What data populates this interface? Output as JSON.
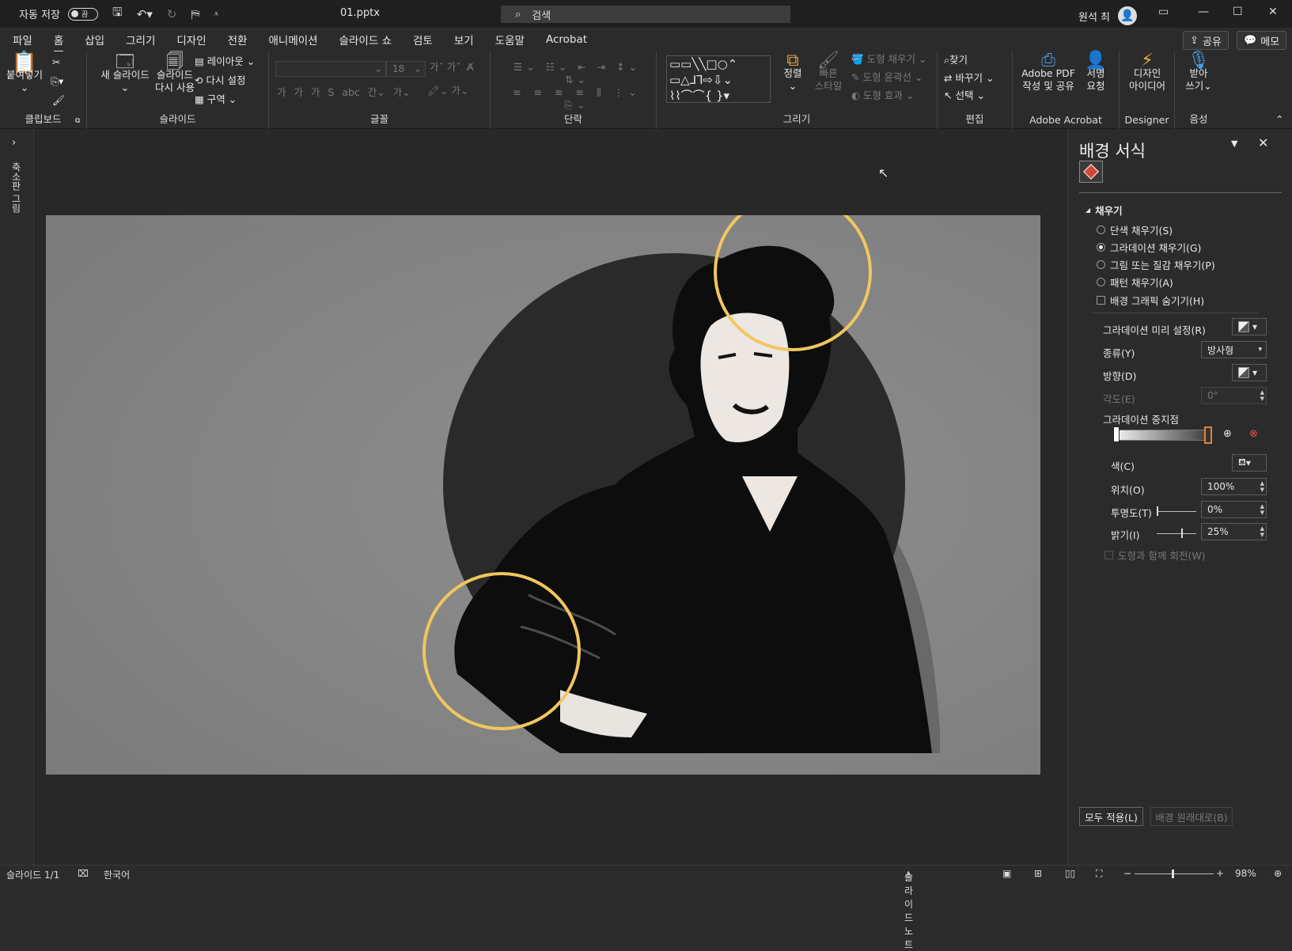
{
  "titlebar": {
    "autosave_label": "자동 저장",
    "autosave_state": "끔",
    "filename": "01.pptx",
    "search_placeholder": "검색",
    "username": "원석 최"
  },
  "menu": {
    "tabs": [
      "파일",
      "홈",
      "삽입",
      "그리기",
      "디자인",
      "전환",
      "애니메이션",
      "슬라이드 쇼",
      "검토",
      "보기",
      "도움말",
      "Acrobat"
    ],
    "active": "홈",
    "share_label": "공유",
    "comment_label": "메모"
  },
  "ribbon": {
    "clipboard": {
      "paste": "붙여넣기",
      "label": "클립보드"
    },
    "slides": {
      "new_slide": "새 슬라이드",
      "reuse_1": "슬라이드",
      "reuse_2": "다시 사용",
      "layout": "레이아웃",
      "reset": "다시 설정",
      "section": "구역",
      "label": "슬라이드"
    },
    "font": {
      "size": "18",
      "label": "글꼴"
    },
    "paragraph": {
      "label": "단락"
    },
    "drawing": {
      "arrange": "정렬",
      "quick_style_1": "빠른",
      "quick_style_2": "스타일",
      "shape_fill": "도형 채우기",
      "shape_outline": "도형 윤곽선",
      "shape_effect": "도형 효과",
      "label": "그리기"
    },
    "editing": {
      "find": "찾기",
      "replace": "바꾸기",
      "select": "선택",
      "label": "편집"
    },
    "acrobat": {
      "create_1": "Adobe PDF",
      "create_2": "작성 및 공유",
      "sign_1": "서명",
      "sign_2": "요청",
      "label": "Adobe Acrobat"
    },
    "designer": {
      "idea_1": "디자인",
      "idea_2": "아이디어",
      "label": "Designer"
    },
    "voice": {
      "dictate_1": "받아",
      "dictate_2": "쓰기",
      "label": "음성"
    }
  },
  "left_pane": {
    "label": "축소판 그림"
  },
  "panel": {
    "title": "배경 서식",
    "section": "채우기",
    "options": [
      "단색 채우기(S)",
      "그라데이션 채우기(G)",
      "그림 또는 질감 채우기(P)",
      "패턴 채우기(A)"
    ],
    "selected_option": 1,
    "hide_bg_graphics": "배경 그래픽 숨기기(H)",
    "preset_label": "그라데이션 미리 설정(R)",
    "type_label": "종류(Y)",
    "type_value": "방사형",
    "direction_label": "방향(D)",
    "angle_label": "각도(E)",
    "angle_value": "0°",
    "stops_label": "그라데이션 중지점",
    "color_label": "색(C)",
    "position_label": "위치(O)",
    "position_value": "100%",
    "transparency_label": "투명도(T)",
    "transparency_value": "0%",
    "transparency_level": 0,
    "brightness_label": "밝기(I)",
    "brightness_value": "25%",
    "brightness_level": 0.625,
    "rotate_with_shape": "도형과 함께 회전(W)",
    "apply_all": "모두 적용(L)",
    "reset_bg": "배경 원래대로(B)"
  },
  "statusbar": {
    "slide_count": "슬라이드 1/1",
    "language": "한국어",
    "notes": "슬라이드 노트",
    "zoom": "98%"
  },
  "colors": {
    "accent_ring": "#f2c65f",
    "slide_bg": "#838383",
    "circle": "#2a2a2a"
  }
}
